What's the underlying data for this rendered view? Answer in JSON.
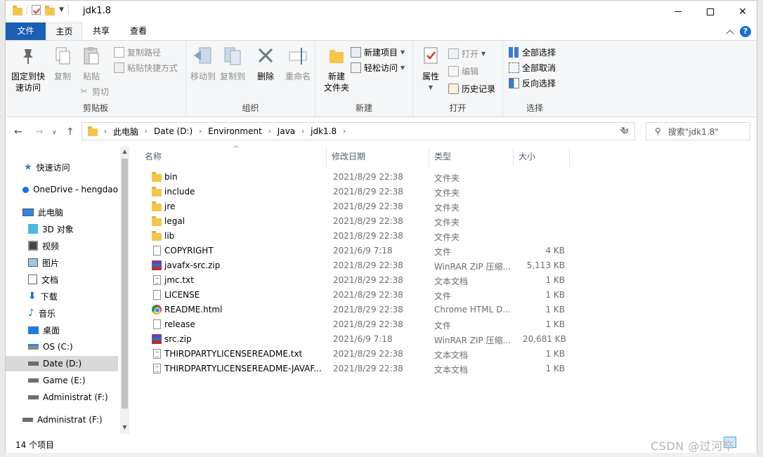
{
  "window": {
    "title": "jdk1.8"
  },
  "ribbon_tabs": [
    "文件",
    "主页",
    "共享",
    "查看"
  ],
  "ribbon": {
    "clipboard": {
      "pin": "固定到快\n速访问",
      "pin_l1": "固定到快",
      "pin_l2": "速访问",
      "copy": "复制",
      "paste": "粘贴",
      "copy_path": "复制路径",
      "paste_shortcut": "粘贴快捷方式",
      "cut": "剪切",
      "label": "剪贴板"
    },
    "organize": {
      "move_to": "移动到",
      "copy_to": "复制到",
      "delete": "删除",
      "rename": "重命名",
      "label": "组织"
    },
    "new": {
      "new_folder_l1": "新建",
      "new_folder_l2": "文件夹",
      "new_item": "新建项目",
      "easy_access": "轻松访问",
      "label": "新建"
    },
    "open": {
      "properties": "属性",
      "open": "打开",
      "edit": "编辑",
      "history": "历史记录",
      "label": "打开"
    },
    "select": {
      "select_all": "全部选择",
      "select_none": "全部取消",
      "invert": "反向选择",
      "label": "选择"
    }
  },
  "address": {
    "crumbs": [
      "此电脑",
      "Date (D:)",
      "Environment",
      "Java",
      "jdk1.8"
    ],
    "search_placeholder": "搜索\"jdk1.8\""
  },
  "sidebar": {
    "items": [
      {
        "label": "快速访问",
        "icon": "star-icon"
      },
      {
        "label": "OneDrive - hengdao",
        "icon": "cloud-icon"
      },
      {
        "label": "此电脑",
        "icon": "computer-icon"
      },
      {
        "label": "3D 对象",
        "icon": "cube-icon"
      },
      {
        "label": "视频",
        "icon": "video-icon"
      },
      {
        "label": "图片",
        "icon": "picture-icon"
      },
      {
        "label": "文档",
        "icon": "document-icon"
      },
      {
        "label": "下载",
        "icon": "download-icon"
      },
      {
        "label": "音乐",
        "icon": "music-icon"
      },
      {
        "label": "桌面",
        "icon": "desktop-icon"
      },
      {
        "label": "OS (C:)",
        "icon": "drive-icon"
      },
      {
        "label": "Date (D:)",
        "icon": "drive-icon"
      },
      {
        "label": "Game (E:)",
        "icon": "drive-icon"
      },
      {
        "label": "Administrat (F:)",
        "icon": "drive-icon"
      },
      {
        "label": "Administrat (F:)",
        "icon": "drive-icon"
      }
    ]
  },
  "columns": {
    "name": "名称",
    "date": "修改日期",
    "type": "类型",
    "size": "大小"
  },
  "files": [
    {
      "name": "bin",
      "date": "2021/8/29 22:38",
      "type": "文件夹",
      "size": "",
      "icon": "folder-icon"
    },
    {
      "name": "include",
      "date": "2021/8/29 22:38",
      "type": "文件夹",
      "size": "",
      "icon": "folder-icon"
    },
    {
      "name": "jre",
      "date": "2021/8/29 22:38",
      "type": "文件夹",
      "size": "",
      "icon": "folder-icon"
    },
    {
      "name": "legal",
      "date": "2021/8/29 22:38",
      "type": "文件夹",
      "size": "",
      "icon": "folder-icon"
    },
    {
      "name": "lib",
      "date": "2021/8/29 22:38",
      "type": "文件夹",
      "size": "",
      "icon": "folder-icon"
    },
    {
      "name": "COPYRIGHT",
      "date": "2021/6/9 7:18",
      "type": "文件",
      "size": "4 KB",
      "icon": "file-icon"
    },
    {
      "name": "javafx-src.zip",
      "date": "2021/8/29 22:38",
      "type": "WinRAR ZIP 压缩...",
      "size": "5,113 KB",
      "icon": "winrar-icon"
    },
    {
      "name": "jmc.txt",
      "date": "2021/8/29 22:38",
      "type": "文本文档",
      "size": "1 KB",
      "icon": "text-file-icon"
    },
    {
      "name": "LICENSE",
      "date": "2021/8/29 22:38",
      "type": "文件",
      "size": "1 KB",
      "icon": "file-icon"
    },
    {
      "name": "README.html",
      "date": "2021/8/29 22:38",
      "type": "Chrome HTML D...",
      "size": "1 KB",
      "icon": "chrome-icon"
    },
    {
      "name": "release",
      "date": "2021/8/29 22:38",
      "type": "文件",
      "size": "1 KB",
      "icon": "file-icon"
    },
    {
      "name": "src.zip",
      "date": "2021/6/9 7:18",
      "type": "WinRAR ZIP 压缩...",
      "size": "20,681 KB",
      "icon": "winrar-icon"
    },
    {
      "name": "THIRDPARTYLICENSEREADME.txt",
      "date": "2021/8/29 22:38",
      "type": "文本文档",
      "size": "1 KB",
      "icon": "text-file-icon"
    },
    {
      "name": "THIRDPARTYLICENSEREADME-JAVAF...",
      "date": "2021/8/29 22:38",
      "type": "文本文档",
      "size": "1 KB",
      "icon": "text-file-icon"
    }
  ],
  "status": {
    "item_count": "14 个项目"
  },
  "watermark": "CSDN @过河卒"
}
